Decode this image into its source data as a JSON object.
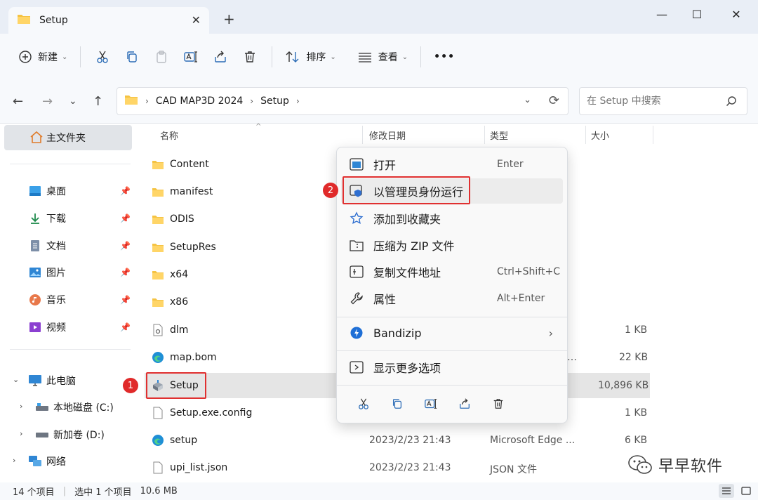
{
  "window": {
    "tab_title": "Setup",
    "tab_close": "✕",
    "new_tab": "+",
    "minimize": "—",
    "maximize": "☐",
    "close": "✕"
  },
  "toolbar": {
    "new_label": "新建",
    "sort_label": "排序",
    "view_label": "查看",
    "more_label": "•••"
  },
  "address": {
    "crumbs": [
      "CAD MAP3D 2024",
      "Setup"
    ],
    "search_placeholder": "在 Setup 中搜索"
  },
  "sidebar": {
    "home": "主文件夹",
    "quick": [
      {
        "label": "桌面"
      },
      {
        "label": "下载"
      },
      {
        "label": "文档"
      },
      {
        "label": "图片"
      },
      {
        "label": "音乐"
      },
      {
        "label": "视频"
      }
    ],
    "this_pc": "此电脑",
    "drives": [
      {
        "label": "本地磁盘 (C:)"
      },
      {
        "label": "新加卷 (D:)"
      }
    ],
    "network": "网络"
  },
  "columns": {
    "name": "名称",
    "date": "修改日期",
    "type": "类型",
    "size": "大小"
  },
  "files": [
    {
      "name": "Content",
      "date": "",
      "type": "",
      "size": ""
    },
    {
      "name": "manifest",
      "date": "",
      "type": "",
      "size": ""
    },
    {
      "name": "ODIS",
      "date": "",
      "type": "",
      "size": ""
    },
    {
      "name": "SetupRes",
      "date": "",
      "type": "",
      "size": ""
    },
    {
      "name": "x64",
      "date": "",
      "type": "",
      "size": ""
    },
    {
      "name": "x86",
      "date": "",
      "type": "",
      "size": ""
    },
    {
      "name": "dlm",
      "date": "",
      "type": "",
      "size": "1 KB"
    },
    {
      "name": "map.bom",
      "date": "",
      "type": "…",
      "size": "22 KB"
    },
    {
      "name": "Setup",
      "date": "",
      "type": "",
      "size": "10,896 KB"
    },
    {
      "name": "Setup.exe.config",
      "date": "",
      "type": "",
      "size": "1 KB"
    },
    {
      "name": "setup",
      "date": "2023/2/23 21:43",
      "type": "Microsoft Edge ...",
      "size": "6 KB"
    },
    {
      "name": "upi_list.json",
      "date": "2023/2/23 21:43",
      "type": "JSON 文件",
      "size": "1 KB"
    }
  ],
  "context_menu": {
    "open": "打开",
    "open_sc": "Enter",
    "run_admin": "以管理员身份运行",
    "add_fav": "添加到收藏夹",
    "zip": "压缩为 ZIP 文件",
    "copy_path": "复制文件地址",
    "copy_path_sc": "Ctrl+Shift+C",
    "props": "属性",
    "props_sc": "Alt+Enter",
    "bandizip": "Bandizip",
    "more": "显示更多选项"
  },
  "annotations": {
    "badge1": "1",
    "badge2": "2"
  },
  "status": {
    "count": "14 个项目",
    "selected": "选中 1 个项目",
    "size": "10.6 MB"
  },
  "watermark": "早早软件",
  "colors": {
    "accent": "#0067c0",
    "folder": "#f5c343",
    "highlight_red": "#e03030"
  }
}
